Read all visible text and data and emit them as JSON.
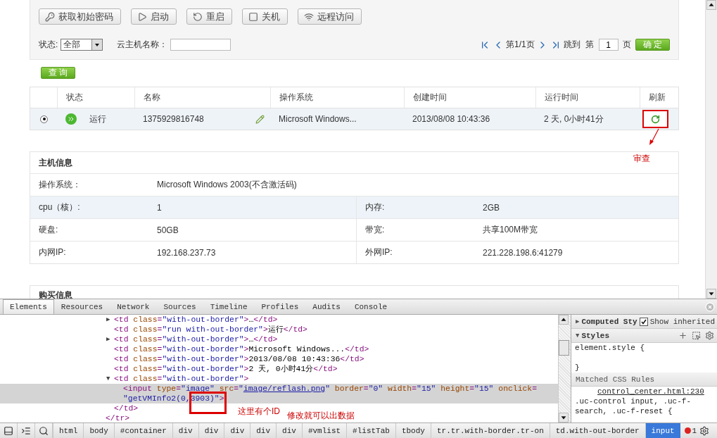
{
  "toolbar": {
    "buttons": [
      {
        "label": "获取初始密码"
      },
      {
        "label": "启动"
      },
      {
        "label": "重启"
      },
      {
        "label": "关机"
      },
      {
        "label": "远程访问"
      }
    ]
  },
  "filters": {
    "status_label": "状态:",
    "status_value": "全部",
    "name_label": "云主机名称：",
    "query_button": "查 询"
  },
  "pager": {
    "page_info": "第1/1页",
    "jump_label": "跳到",
    "page_prefix": "第",
    "page_value": "1",
    "page_suffix": "页",
    "confirm_button": "确 定"
  },
  "table": {
    "columns": [
      "状态",
      "名称",
      "操作系统",
      "创建时间",
      "运行时间",
      "刷新"
    ],
    "rows": [
      {
        "selected": true,
        "status": "运行",
        "name": "1375929816748",
        "os": "Microsoft Windows...",
        "created": "2013/08/08 10:43:36",
        "uptime": "2 天, 0小时41分"
      }
    ]
  },
  "annotations": {
    "refresh_note": "审查",
    "id_note": "这里有个ID",
    "edit_note": "修改就可以出数据"
  },
  "host_info": {
    "title": "主机信息",
    "rows": [
      {
        "highlighted": false,
        "cells": [
          {
            "label": "操作系统：",
            "value": "Microsoft Windows 2003(不含激活码)"
          }
        ]
      },
      {
        "highlighted": true,
        "cells": [
          {
            "label": "cpu（核）:",
            "value": "1"
          },
          {
            "label": "内存:",
            "value": "2GB"
          }
        ]
      },
      {
        "highlighted": false,
        "cells": [
          {
            "label": "硬盘:",
            "value": "50GB"
          },
          {
            "label": "带宽:",
            "value": "共享100M带宽"
          }
        ]
      },
      {
        "highlighted": false,
        "cells": [
          {
            "label": "内网IP:",
            "value": "192.168.237.73"
          },
          {
            "label": "外网IP:",
            "value": "221.228.198.6:41279"
          }
        ]
      }
    ]
  },
  "purchase_info": {
    "title": "购买信息"
  },
  "devtools": {
    "tabs": [
      {
        "label": "Elements",
        "selected": true
      },
      {
        "label": "Resources",
        "selected": false
      },
      {
        "label": "Network",
        "selected": false
      },
      {
        "label": "Sources",
        "selected": false
      },
      {
        "label": "Timeline",
        "selected": false
      },
      {
        "label": "Profiles",
        "selected": false
      },
      {
        "label": "Audits",
        "selected": false
      },
      {
        "label": "Console",
        "selected": false
      }
    ],
    "dom": {
      "children": [
        {
          "arrow": "▶",
          "selected": false,
          "lines": [
            [
              {
                "kind": "tag",
                "s": "<td "
              },
              {
                "kind": "attr",
                "s": "class"
              },
              {
                "kind": "tag",
                "s": "="
              },
              {
                "kind": "value",
                "s": "\"with-out-border\""
              },
              {
                "kind": "tag",
                "s": ">"
              },
              {
                "kind": "text",
                "s": "…"
              },
              {
                "kind": "tag",
                "s": "</td>"
              }
            ]
          ]
        },
        {
          "selected": false,
          "lines": [
            [
              {
                "kind": "tag",
                "s": "<td "
              },
              {
                "kind": "attr",
                "s": "class"
              },
              {
                "kind": "tag",
                "s": "="
              },
              {
                "kind": "value",
                "s": "\"run with-out-border\""
              },
              {
                "kind": "tag",
                "s": ">"
              },
              {
                "kind": "text",
                "s": "运行"
              },
              {
                "kind": "tag",
                "s": "</td>"
              }
            ]
          ]
        },
        {
          "arrow": "▶",
          "selected": false,
          "lines": [
            [
              {
                "kind": "tag",
                "s": "<td "
              },
              {
                "kind": "attr",
                "s": "class"
              },
              {
                "kind": "tag",
                "s": "="
              },
              {
                "kind": "value",
                "s": "\"with-out-border\""
              },
              {
                "kind": "tag",
                "s": ">"
              },
              {
                "kind": "text",
                "s": "…"
              },
              {
                "kind": "tag",
                "s": "</td>"
              }
            ]
          ]
        },
        {
          "selected": false,
          "lines": [
            [
              {
                "kind": "tag",
                "s": "<td "
              },
              {
                "kind": "attr",
                "s": "class"
              },
              {
                "kind": "tag",
                "s": "="
              },
              {
                "kind": "value",
                "s": "\"with-out-border\""
              },
              {
                "kind": "tag",
                "s": ">"
              },
              {
                "kind": "text",
                "s": "Microsoft Windows..."
              },
              {
                "kind": "tag",
                "s": "</td>"
              }
            ]
          ]
        },
        {
          "selected": false,
          "lines": [
            [
              {
                "kind": "tag",
                "s": "<td "
              },
              {
                "kind": "attr",
                "s": "class"
              },
              {
                "kind": "tag",
                "s": "="
              },
              {
                "kind": "value",
                "s": "\"with-out-border\""
              },
              {
                "kind": "tag",
                "s": ">"
              },
              {
                "kind": "text",
                "s": "2013/08/08 10:43:36"
              },
              {
                "kind": "tag",
                "s": "</td>"
              }
            ]
          ]
        },
        {
          "selected": false,
          "lines": [
            [
              {
                "kind": "tag",
                "s": "<td "
              },
              {
                "kind": "attr",
                "s": "class"
              },
              {
                "kind": "tag",
                "s": "="
              },
              {
                "kind": "value",
                "s": "\"with-out-border\""
              },
              {
                "kind": "tag",
                "s": ">"
              },
              {
                "kind": "text",
                "s": "2 天, 0小时41分"
              },
              {
                "kind": "tag",
                "s": "</td>"
              }
            ]
          ]
        },
        {
          "arrow": "▼",
          "selected": false,
          "lines": [
            [
              {
                "kind": "tag",
                "s": "<td "
              },
              {
                "kind": "attr",
                "s": "class"
              },
              {
                "kind": "tag",
                "s": "="
              },
              {
                "kind": "value",
                "s": "\"with-out-border\""
              },
              {
                "kind": "tag",
                "s": ">"
              }
            ]
          ],
          "children": [
            {
              "selected": true,
              "lines": [
                [
                  {
                    "kind": "tag",
                    "s": "<input "
                  },
                  {
                    "kind": "attr",
                    "s": "type"
                  },
                  {
                    "kind": "tag",
                    "s": "="
                  },
                  {
                    "kind": "value",
                    "s": "\"image\" "
                  },
                  {
                    "kind": "attr",
                    "s": "src"
                  },
                  {
                    "kind": "tag",
                    "s": "="
                  },
                  {
                    "kind": "value",
                    "s": "\""
                  },
                  {
                    "kind": "link",
                    "s": "image/reflash.png"
                  },
                  {
                    "kind": "value",
                    "s": "\" "
                  },
                  {
                    "kind": "attr",
                    "s": "border"
                  },
                  {
                    "kind": "tag",
                    "s": "="
                  },
                  {
                    "kind": "value",
                    "s": "\"0\" "
                  },
                  {
                    "kind": "attr",
                    "s": "width"
                  },
                  {
                    "kind": "tag",
                    "s": "="
                  },
                  {
                    "kind": "value",
                    "s": "\"15\" "
                  },
                  {
                    "kind": "attr",
                    "s": "height"
                  },
                  {
                    "kind": "tag",
                    "s": "="
                  },
                  {
                    "kind": "value",
                    "s": "\"15\" "
                  },
                  {
                    "kind": "attr",
                    "s": "onclick"
                  },
                  {
                    "kind": "tag",
                    "s": "="
                  }
                ],
                [
                  {
                    "kind": "value",
                    "s": "\"getVMInfo2(0,3903)\""
                  },
                  {
                    "kind": "tag",
                    "s": ">"
                  }
                ]
              ]
            }
          ],
          "close": [
            {
              "kind": "tag",
              "s": "</td>"
            }
          ]
        }
      ],
      "close": [
        {
          "kind": "tag",
          "s": "</tr>"
        }
      ]
    },
    "styles": {
      "computed_arrow": "▶",
      "computed_title": "Computed Sty",
      "show_inherited": {
        "label": "Show inherited",
        "checked": true
      },
      "styles_arrow": "▼",
      "styles_title": "Styles",
      "element_open": "element.style {",
      "element_close": "}",
      "matched_title": "Matched CSS Rules",
      "source_link": "control_center.html:230",
      "selector_1": ".uc-control input, .uc-f-",
      "selector_2": "search, .uc-f-reset {"
    },
    "breadcrumbs": [
      {
        "label": "html",
        "selected": false
      },
      {
        "label": "body",
        "selected": false
      },
      {
        "label": "#container",
        "selected": false
      },
      {
        "label": "div",
        "selected": false
      },
      {
        "label": "div",
        "selected": false
      },
      {
        "label": "div",
        "selected": false
      },
      {
        "label": "div",
        "selected": false
      },
      {
        "label": "div",
        "selected": false
      },
      {
        "label": "#vmlist",
        "selected": false
      },
      {
        "label": "#listTab",
        "selected": false
      },
      {
        "label": "tbody",
        "selected": false
      },
      {
        "label": "tr.tr.with-border.tr-on",
        "selected": false
      },
      {
        "label": "td.with-out-border",
        "selected": false
      },
      {
        "label": "input",
        "selected": true
      }
    ],
    "error_count": "1"
  }
}
